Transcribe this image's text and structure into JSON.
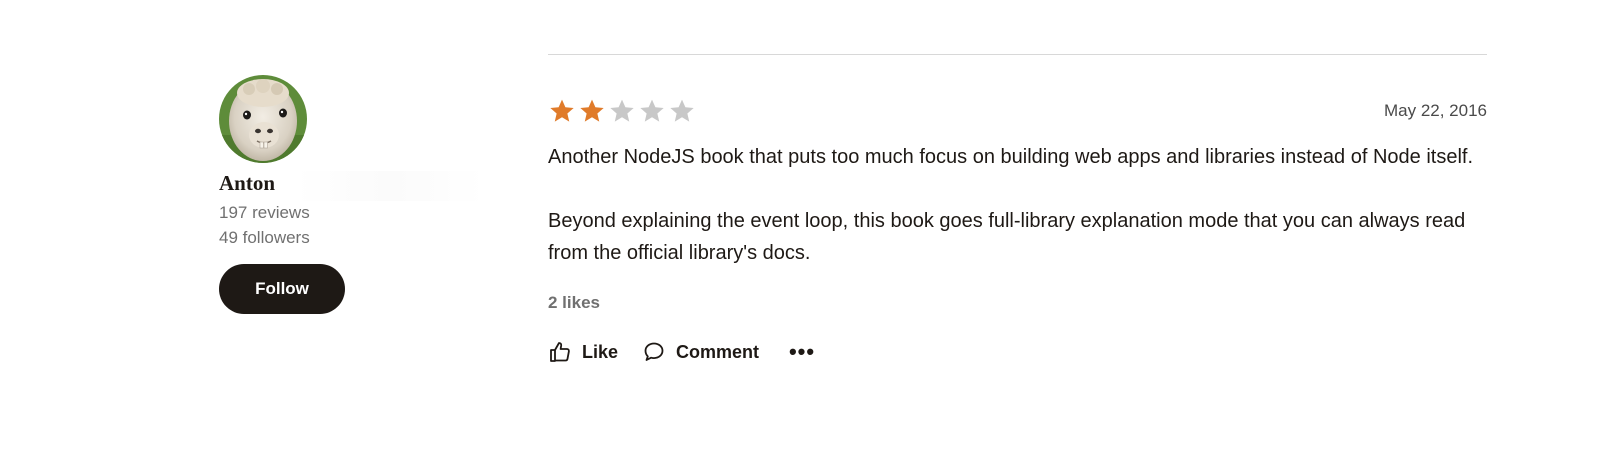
{
  "reviewer": {
    "name": "Anton",
    "reviews": "197 reviews",
    "followers": "49 followers",
    "follow_label": "Follow",
    "avatar_icon": "alpaca-avatar"
  },
  "review": {
    "rating": 2,
    "max_rating": 5,
    "date": "May 22, 2016",
    "paragraphs": [
      "Another NodeJS book that puts too much focus on building web apps and libraries instead of Node itself.",
      "Beyond explaining the event loop, this book goes full-library explanation mode that you can always read from the official library's docs."
    ],
    "likes": "2 likes",
    "actions": {
      "like_label": "Like",
      "comment_label": "Comment",
      "more_label": "•••"
    }
  },
  "colors": {
    "star_filled": "#e07b2a",
    "star_empty": "#c8c8c8",
    "button_dark": "#1e1915",
    "muted_text": "#707070"
  }
}
